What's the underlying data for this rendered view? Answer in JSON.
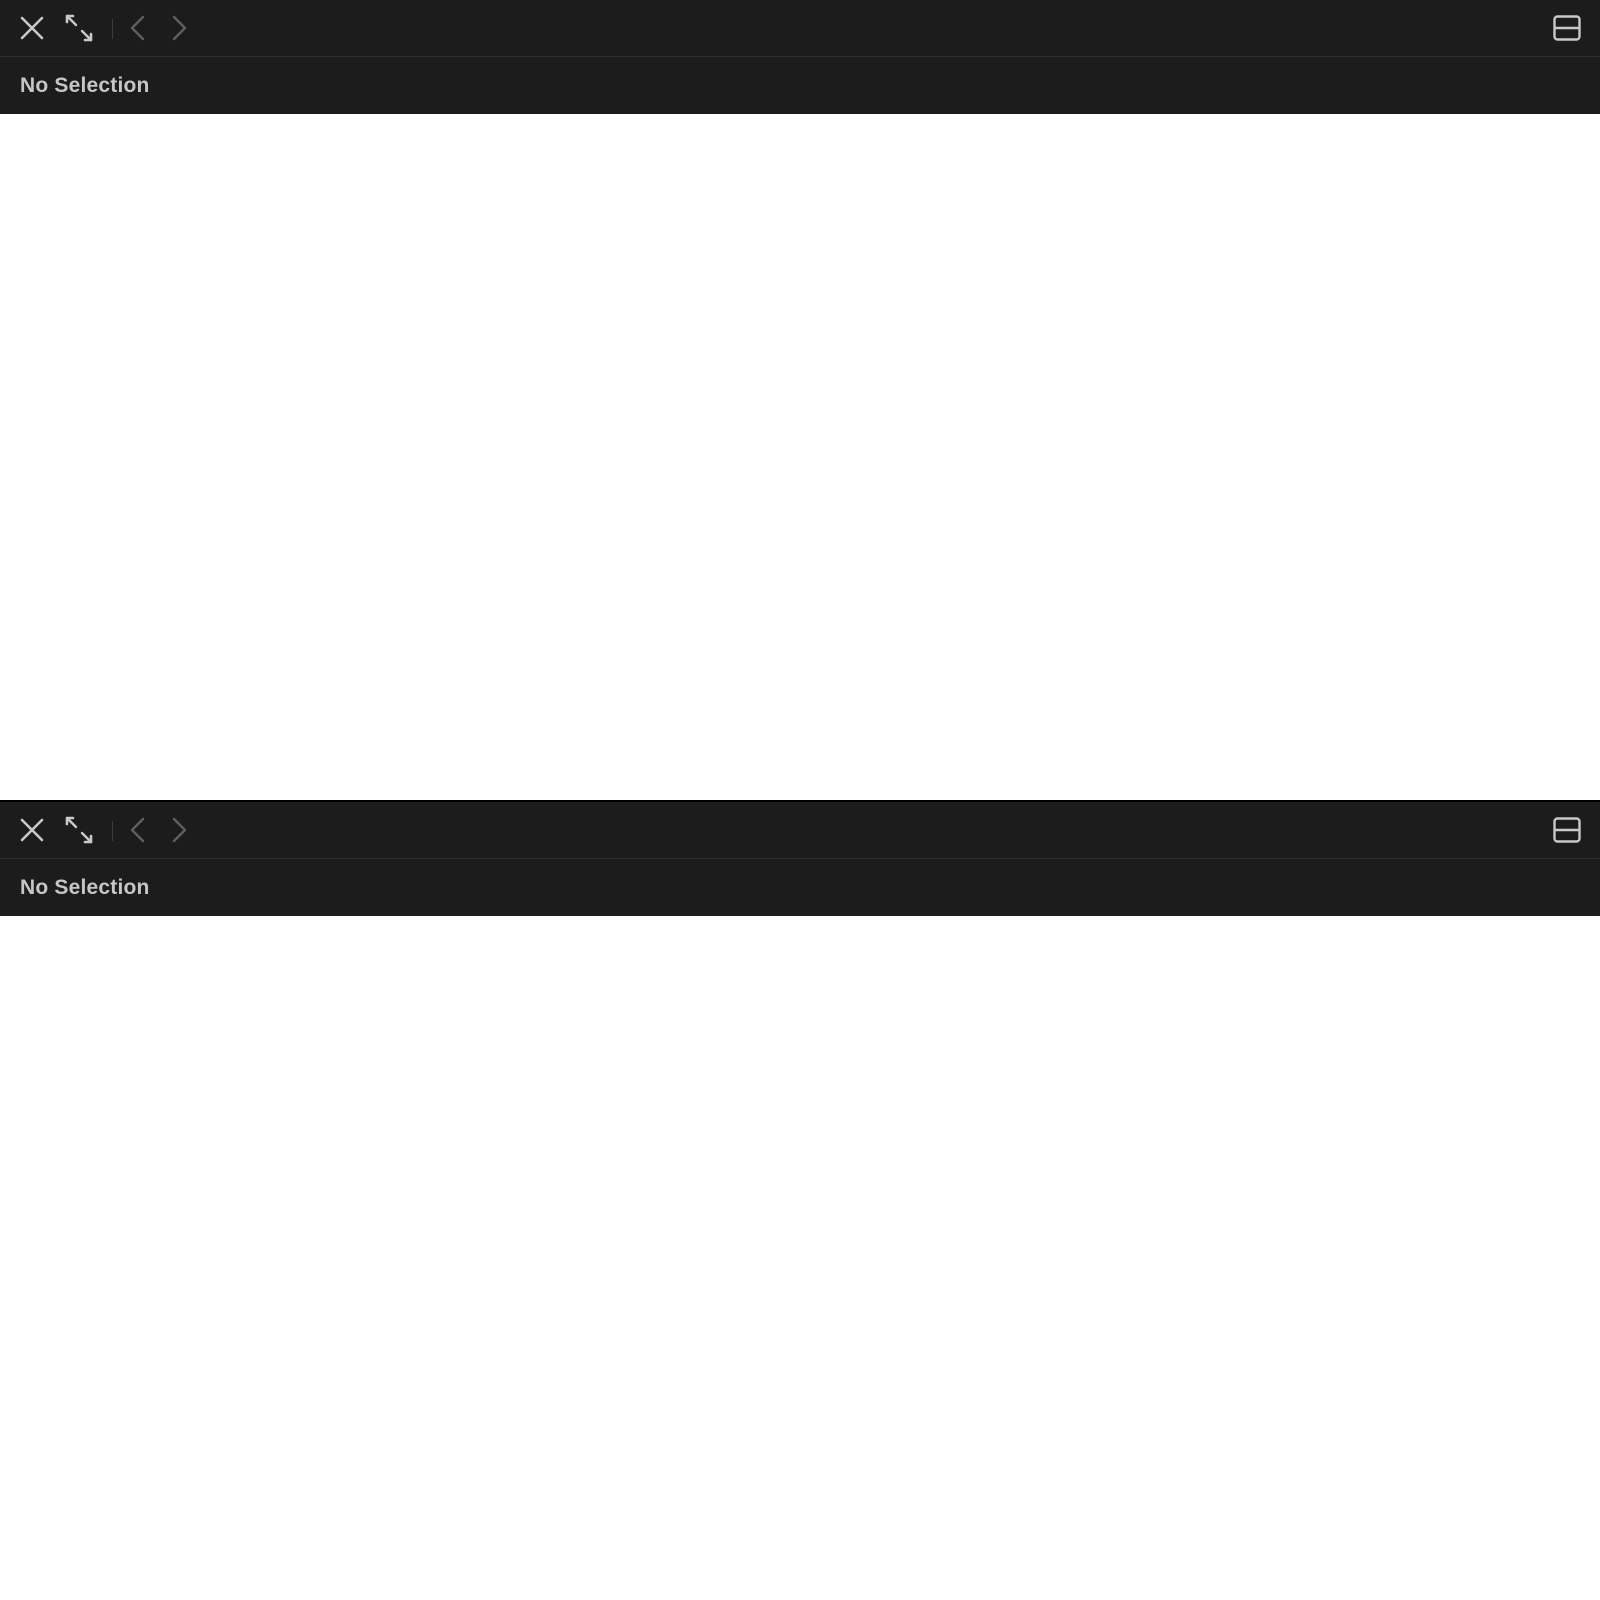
{
  "panes": [
    {
      "toolbar": {
        "icons": [
          "close-icon",
          "expand-icon",
          "chevron-left-icon",
          "chevron-right-icon",
          "split-layout-icon"
        ]
      },
      "title": "No Selection"
    },
    {
      "toolbar": {
        "icons": [
          "close-icon",
          "expand-icon",
          "chevron-left-icon",
          "chevron-right-icon",
          "split-layout-icon"
        ]
      },
      "title": "No Selection"
    }
  ],
  "colors": {
    "toolbar_background": "#1c1c1d",
    "title_text": "#c6c6c8",
    "icon_active": "#c9c9cb",
    "icon_disabled": "#5f5f62",
    "content_background": "#ffffff"
  }
}
